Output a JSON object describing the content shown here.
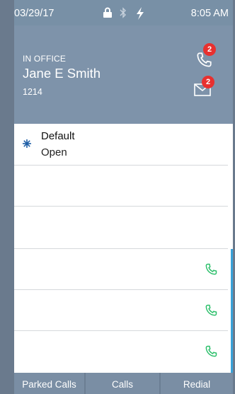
{
  "status_bar": {
    "date": "03/29/17",
    "time": "8:05 AM",
    "icons": [
      "lock-icon",
      "bluetooth-icon",
      "power-icon"
    ]
  },
  "header": {
    "presence": "IN OFFICE",
    "name": "Jane E Smith",
    "extension": "1214",
    "calls_badge": "2",
    "messages_badge": "2"
  },
  "lines": [
    {
      "label": "Default",
      "status": "Open",
      "icon": "sparkle-icon"
    },
    {
      "label": "",
      "status": ""
    },
    {
      "label": "",
      "status": ""
    },
    {
      "label": "",
      "status": "",
      "action": "phone-icon"
    },
    {
      "label": "",
      "status": "",
      "action": "phone-icon"
    },
    {
      "label": "",
      "status": "",
      "action": "phone-icon"
    }
  ],
  "softkeys": [
    "Parked Calls",
    "Calls",
    "Redial"
  ],
  "colors": {
    "header_bg": "#7e93aa",
    "badge": "#e8302f",
    "phone_green": "#2bbf6a",
    "accent": "#3aa3da"
  }
}
